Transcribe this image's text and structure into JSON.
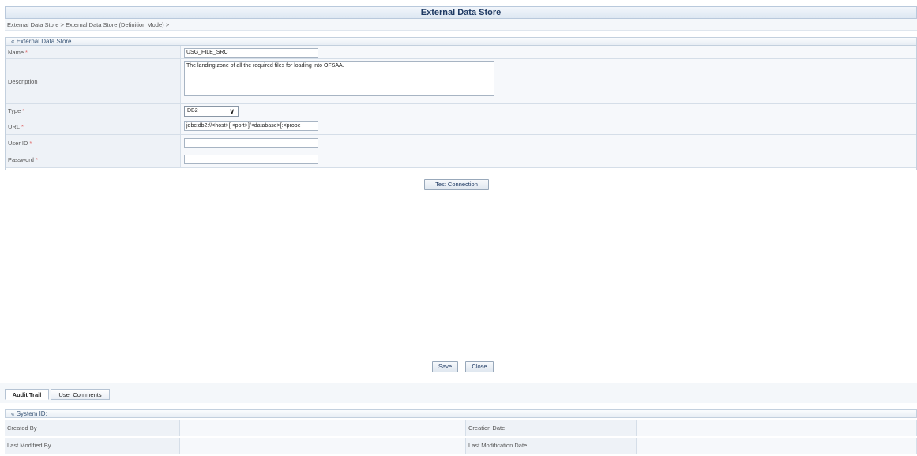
{
  "page": {
    "title": "External Data Store"
  },
  "breadcrumb": "External Data Store > External Data Store (Definition Mode) >",
  "form": {
    "section_title": "External Data Store",
    "fields": {
      "name": {
        "label": "Name",
        "value": "USG_FILE_SRC"
      },
      "description": {
        "label": "Description",
        "value": "The landing zone of all the required files for loading into OFSAA."
      },
      "type": {
        "label": "Type",
        "value": "DB2"
      },
      "url": {
        "label": "URL",
        "value": "jdbc:db2://<host>[:<port>]/<database>[:<prope"
      },
      "user_id": {
        "label": "User ID",
        "value": ""
      },
      "password": {
        "label": "Password",
        "value": ""
      }
    },
    "required_mark": "*"
  },
  "buttons": {
    "test_connection": "Test Connection",
    "save": "Save",
    "close": "Close"
  },
  "tabs": [
    {
      "label": "Audit Trail",
      "active": true
    },
    {
      "label": "User Comments",
      "active": false
    }
  ],
  "audit": {
    "section_title": "System ID:",
    "created_by": "Created By",
    "creation_date": "Creation Date",
    "last_modified_by": "Last Modified By",
    "last_modification_date": "Last Modification Date"
  },
  "icons": {
    "collapse": "collapse-icon",
    "dropdown": "chevron-down-icon"
  },
  "colors": {
    "header_text": "#1f3a63",
    "required": "#e06a6a",
    "border": "#c3d0de"
  }
}
